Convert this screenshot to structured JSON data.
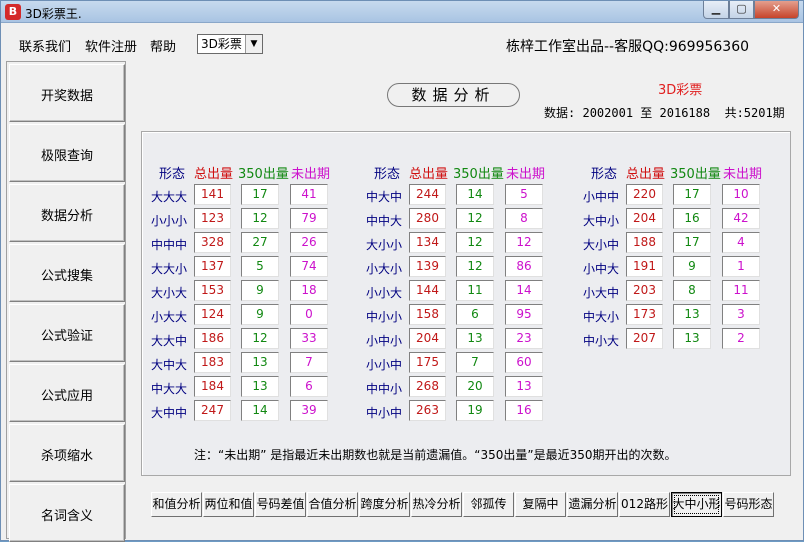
{
  "window": {
    "title": "3D彩票王.",
    "icon_label": "B"
  },
  "menu": [
    "联系我们",
    "软件注册",
    "帮助"
  ],
  "lottery_select": {
    "value": "3D彩票"
  },
  "studio_text": "栋梓工作室出品--客服QQ:969956360",
  "sidebar": [
    "开奖数据",
    "极限查询",
    "数据分析",
    "公式搜集",
    "公式验证",
    "公式应用",
    "杀项缩水",
    "名词含义"
  ],
  "banner": "数据分析",
  "lottery_name": "3D彩票",
  "range": {
    "label": "数据:",
    "from": "2002001",
    "to_word": "至",
    "to": "2016188",
    "total": "共:5201期"
  },
  "headers": {
    "pattern": "形态",
    "total": "总出量",
    "recent": "350出量",
    "missing": "未出期"
  },
  "groups": [
    {
      "rows": [
        {
          "pattern": "大大大",
          "total": "141",
          "recent": "17",
          "missing": "41"
        },
        {
          "pattern": "小小小",
          "total": "123",
          "recent": "12",
          "missing": "79"
        },
        {
          "pattern": "中中中",
          "total": "328",
          "recent": "27",
          "missing": "26"
        },
        {
          "pattern": "大大小",
          "total": "137",
          "recent": "5",
          "missing": "74"
        },
        {
          "pattern": "大小大",
          "total": "153",
          "recent": "9",
          "missing": "18"
        },
        {
          "pattern": "小大大",
          "total": "124",
          "recent": "9",
          "missing": "0"
        },
        {
          "pattern": "大大中",
          "total": "186",
          "recent": "12",
          "missing": "33"
        },
        {
          "pattern": "大中大",
          "total": "183",
          "recent": "13",
          "missing": "7"
        },
        {
          "pattern": "中大大",
          "total": "184",
          "recent": "13",
          "missing": "6"
        },
        {
          "pattern": "大中中",
          "total": "247",
          "recent": "14",
          "missing": "39"
        }
      ]
    },
    {
      "rows": [
        {
          "pattern": "中大中",
          "total": "244",
          "recent": "14",
          "missing": "5"
        },
        {
          "pattern": "中中大",
          "total": "280",
          "recent": "12",
          "missing": "8"
        },
        {
          "pattern": "大小小",
          "total": "134",
          "recent": "12",
          "missing": "12"
        },
        {
          "pattern": "小大小",
          "total": "139",
          "recent": "12",
          "missing": "86"
        },
        {
          "pattern": "小小大",
          "total": "144",
          "recent": "11",
          "missing": "14"
        },
        {
          "pattern": "中小小",
          "total": "158",
          "recent": "6",
          "missing": "95"
        },
        {
          "pattern": "小中小",
          "total": "204",
          "recent": "13",
          "missing": "23"
        },
        {
          "pattern": "小小中",
          "total": "175",
          "recent": "7",
          "missing": "60"
        },
        {
          "pattern": "中中小",
          "total": "268",
          "recent": "20",
          "missing": "13"
        },
        {
          "pattern": "中小中",
          "total": "263",
          "recent": "19",
          "missing": "16"
        }
      ]
    },
    {
      "rows": [
        {
          "pattern": "小中中",
          "total": "220",
          "recent": "17",
          "missing": "10"
        },
        {
          "pattern": "大中小",
          "total": "204",
          "recent": "16",
          "missing": "42"
        },
        {
          "pattern": "大小中",
          "total": "188",
          "recent": "17",
          "missing": "4"
        },
        {
          "pattern": "小中大",
          "total": "191",
          "recent": "9",
          "missing": "1"
        },
        {
          "pattern": "小大中",
          "total": "203",
          "recent": "8",
          "missing": "11"
        },
        {
          "pattern": "中大小",
          "total": "173",
          "recent": "13",
          "missing": "3"
        },
        {
          "pattern": "中小大",
          "total": "207",
          "recent": "13",
          "missing": "2"
        }
      ]
    }
  ],
  "note": "注：“未出期” 是指最近未出期数也就是当前遗漏值。“350出量”是最近350期开出的次数。",
  "tabs": [
    "和值分析",
    "两位和值",
    "号码差值",
    "合值分析",
    "跨度分析",
    "热冷分析",
    "邻孤传",
    "复隔中",
    "遗漏分析",
    "012路形",
    "大中小形",
    "号码形态"
  ],
  "active_tab": "大中小形"
}
